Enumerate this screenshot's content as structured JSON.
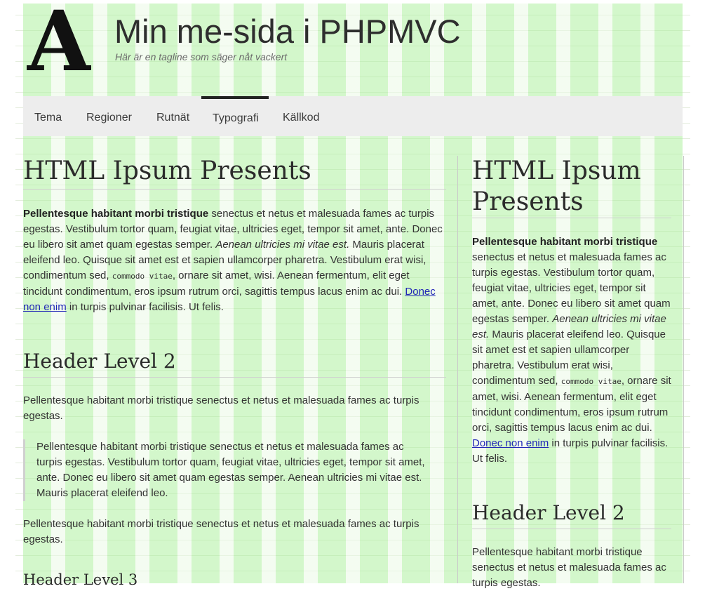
{
  "header": {
    "title": "Min me-sida i PHPMVC",
    "tagline": "Här är en tagline som säger nåt vackert",
    "logo_letter": "A"
  },
  "nav": {
    "items": [
      {
        "label": "Tema"
      },
      {
        "label": "Regioner"
      },
      {
        "label": "Rutnät"
      },
      {
        "label": "Typografi",
        "active": true
      },
      {
        "label": "Källkod"
      }
    ]
  },
  "main": {
    "h1": "HTML Ipsum Presents",
    "p1_bold": "Pellentesque habitant morbi tristique",
    "p1_a": " senectus et netus et malesuada fames ac turpis egestas. Vestibulum tortor quam, feugiat vitae, ultricies eget, tempor sit amet, ante. Donec eu libero sit amet quam egestas semper. ",
    "p1_em": "Aenean ultricies mi vitae est.",
    "p1_b": " Mauris placerat eleifend leo. Quisque sit amet est et sapien ullamcorper pharetra. Vestibulum erat wisi, condimentum sed, ",
    "p1_code": "commodo vitae",
    "p1_c": ", ornare sit amet, wisi. Aenean fermentum, elit eget tincidunt condimentum, eros ipsum rutrum orci, sagittis tempus lacus enim ac dui. ",
    "p1_link": "Donec non enim",
    "p1_d": " in turpis pulvinar facilisis. Ut felis.",
    "h2": "Header Level 2",
    "p2": "Pellentesque habitant morbi tristique senectus et netus et malesuada fames ac turpis egestas.",
    "quote": "Pellentesque habitant morbi tristique senectus et netus et malesuada fames ac turpis egestas. Vestibulum tortor quam, feugiat vitae, ultricies eget, tempor sit amet, ante. Donec eu libero sit amet quam egestas semper. Aenean ultricies mi vitae est. Mauris placerat eleifend leo.",
    "p3": "Pellentesque habitant morbi tristique senectus et netus et malesuada fames ac turpis egestas.",
    "h3": "Header Level 3"
  },
  "sidebar": {
    "h1": "HTML Ipsum Presents",
    "p1_bold": "Pellentesque habitant morbi tristique",
    "p1_a": " senectus et netus et malesuada fames ac turpis egestas. Vestibulum tortor quam, feugiat vitae, ultricies eget, tempor sit amet, ante. Donec eu libero sit amet quam egestas semper. ",
    "p1_em": "Aenean ultricies mi vitae est.",
    "p1_b": " Mauris placerat eleifend leo. Quisque sit amet est et sapien ullamcorper pharetra. Vestibulum erat wisi, condimentum sed, ",
    "p1_code": "commodo vitae",
    "p1_c": ", ornare sit amet, wisi. Aenean fermentum, elit eget tincidunt condimentum, eros ipsum rutrum orci, sagittis tempus lacus enim ac dui. ",
    "p1_link": "Donec non enim",
    "p1_d": " in turpis pulvinar facilisis. Ut felis.",
    "h2": "Header Level 2",
    "p2": "Pellentesque habitant morbi tristique senectus et netus et malesuada fames ac turpis egestas."
  }
}
